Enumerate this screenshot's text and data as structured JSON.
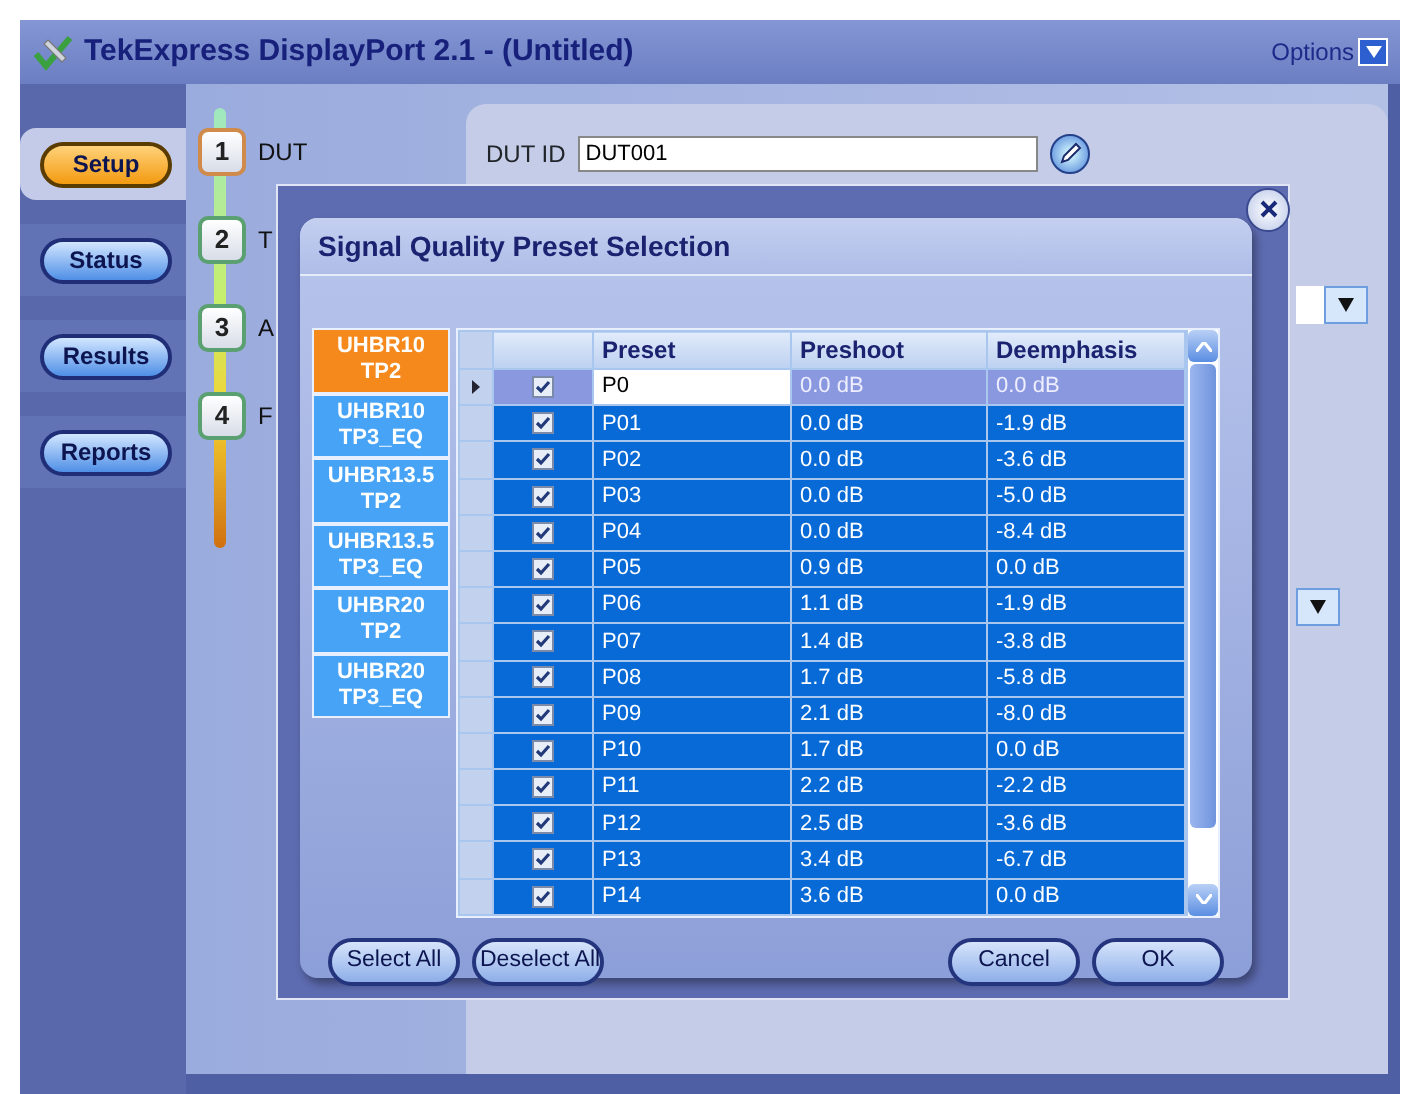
{
  "window": {
    "title": "TekExpress DisplayPort 2.1 - (Untitled)",
    "options": "Options"
  },
  "nav": [
    {
      "label": "Setup",
      "selected": true
    },
    {
      "label": "Status",
      "selected": false
    },
    {
      "label": "Results",
      "selected": false
    },
    {
      "label": "Reports",
      "selected": false
    }
  ],
  "steps": [
    {
      "number": "1",
      "label": "DUT",
      "selected": true
    },
    {
      "number": "2",
      "label": "T",
      "selected": false
    },
    {
      "number": "3",
      "label": "A",
      "selected": false
    },
    {
      "number": "4",
      "label": "F",
      "selected": false
    }
  ],
  "dut_id": {
    "label": "DUT ID",
    "value": "DUT001"
  },
  "dialog": {
    "title": "Signal Quality Preset Selection",
    "tabs": [
      {
        "label": "UHBR10\nTP2",
        "selected": true
      },
      {
        "label": "UHBR10\nTP3_EQ",
        "selected": false
      },
      {
        "label": "UHBR13.5\nTP2",
        "selected": false
      },
      {
        "label": "UHBR13.5\nTP3_EQ",
        "selected": false
      },
      {
        "label": "UHBR20\nTP2",
        "selected": false
      },
      {
        "label": "UHBR20\nTP3_EQ",
        "selected": false
      }
    ],
    "columns": [
      "Preset",
      "Preshoot",
      "Deemphasis"
    ],
    "rows": [
      {
        "preset": "P0",
        "preshoot": "0.0 dB",
        "deemphasis": "0.0 dB",
        "checked": true,
        "current": true,
        "selected": false
      },
      {
        "preset": "P01",
        "preshoot": "0.0 dB",
        "deemphasis": "-1.9 dB",
        "checked": true,
        "current": false,
        "selected": true
      },
      {
        "preset": "P02",
        "preshoot": "0.0 dB",
        "deemphasis": "-3.6 dB",
        "checked": true,
        "current": false,
        "selected": true
      },
      {
        "preset": "P03",
        "preshoot": "0.0 dB",
        "deemphasis": "-5.0 dB",
        "checked": true,
        "current": false,
        "selected": true
      },
      {
        "preset": "P04",
        "preshoot": "0.0 dB",
        "deemphasis": "-8.4 dB",
        "checked": true,
        "current": false,
        "selected": true
      },
      {
        "preset": "P05",
        "preshoot": "0.9 dB",
        "deemphasis": "0.0 dB",
        "checked": true,
        "current": false,
        "selected": true
      },
      {
        "preset": "P06",
        "preshoot": "1.1 dB",
        "deemphasis": "-1.9 dB",
        "checked": true,
        "current": false,
        "selected": true
      },
      {
        "preset": "P07",
        "preshoot": "1.4 dB",
        "deemphasis": "-3.8 dB",
        "checked": true,
        "current": false,
        "selected": true
      },
      {
        "preset": "P08",
        "preshoot": "1.7 dB",
        "deemphasis": "-5.8 dB",
        "checked": true,
        "current": false,
        "selected": true
      },
      {
        "preset": "P09",
        "preshoot": "2.1 dB",
        "deemphasis": "-8.0 dB",
        "checked": true,
        "current": false,
        "selected": true
      },
      {
        "preset": "P10",
        "preshoot": "1.7 dB",
        "deemphasis": "0.0 dB",
        "checked": true,
        "current": false,
        "selected": true
      },
      {
        "preset": "P11",
        "preshoot": "2.2 dB",
        "deemphasis": "-2.2 dB",
        "checked": true,
        "current": false,
        "selected": true
      },
      {
        "preset": "P12",
        "preshoot": "2.5 dB",
        "deemphasis": "-3.6 dB",
        "checked": true,
        "current": false,
        "selected": true
      },
      {
        "preset": "P13",
        "preshoot": "3.4 dB",
        "deemphasis": "-6.7 dB",
        "checked": true,
        "current": false,
        "selected": true
      },
      {
        "preset": "P14",
        "preshoot": "3.6 dB",
        "deemphasis": "0.0 dB",
        "checked": true,
        "current": false,
        "selected": true
      }
    ],
    "left_buttons": [
      "Select All",
      "Deselect All"
    ],
    "right_buttons": [
      "Cancel",
      "OK"
    ]
  }
}
